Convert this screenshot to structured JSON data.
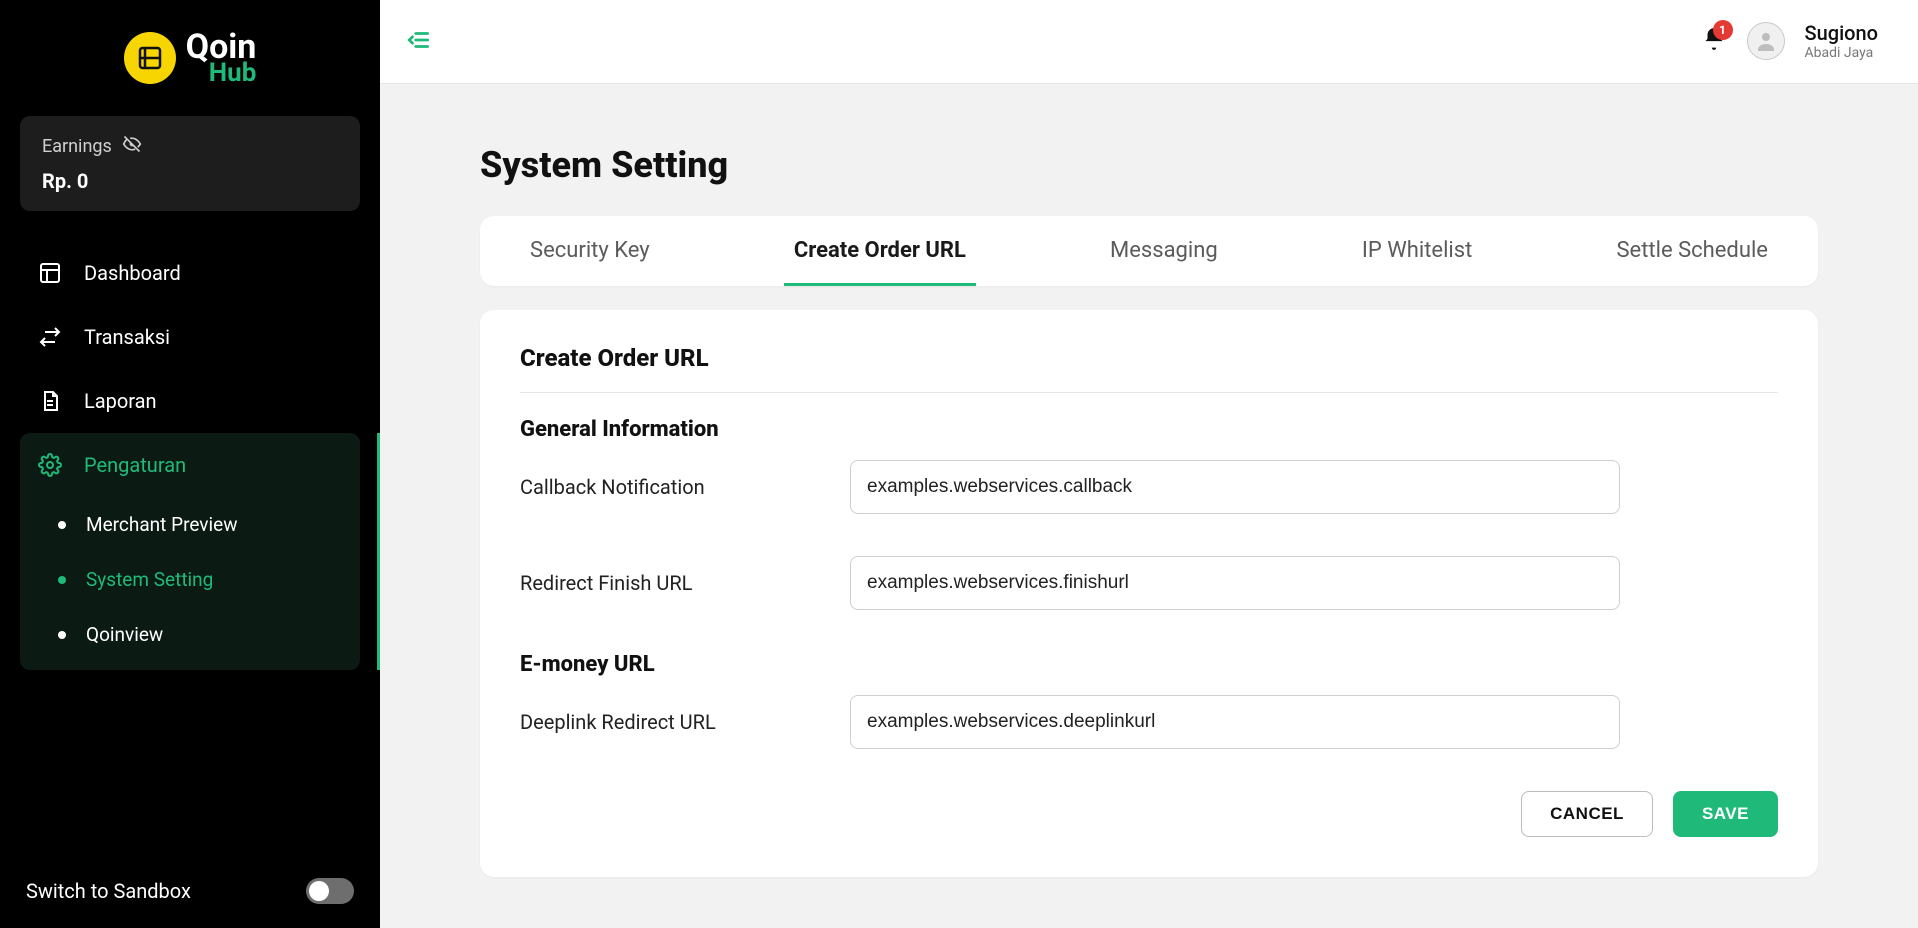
{
  "brand": {
    "line1": "Qoin",
    "line2": "Hub"
  },
  "earnings": {
    "label": "Earnings",
    "value": "Rp. 0"
  },
  "nav": {
    "dashboard": "Dashboard",
    "transaksi": "Transaksi",
    "laporan": "Laporan",
    "pengaturan": "Pengaturan",
    "sub": {
      "merchant_preview": "Merchant Preview",
      "system_setting": "System Setting",
      "qoinview": "Qoinview"
    }
  },
  "sandbox": {
    "label": "Switch to Sandbox",
    "on": false
  },
  "topbar": {
    "notifications": "1",
    "user_name": "Sugiono",
    "user_org": "Abadi Jaya"
  },
  "page": {
    "title": "System Setting"
  },
  "tabs": {
    "security_key": "Security Key",
    "create_order_url": "Create Order URL",
    "messaging": "Messaging",
    "ip_whitelist": "IP Whitelist",
    "settle_schedule": "Settle Schedule"
  },
  "form": {
    "section_title": "Create Order URL",
    "general_heading": "General Information",
    "callback_label": "Callback Notification",
    "callback_value": "examples.webservices.callback",
    "redirect_label": "Redirect Finish URL",
    "redirect_value": "examples.webservices.finishurl",
    "emoney_heading": "E-money URL",
    "deeplink_label": "Deeplink Redirect URL",
    "deeplink_value": "examples.webservices.deeplinkurl",
    "cancel": "CANCEL",
    "save": "SAVE"
  }
}
